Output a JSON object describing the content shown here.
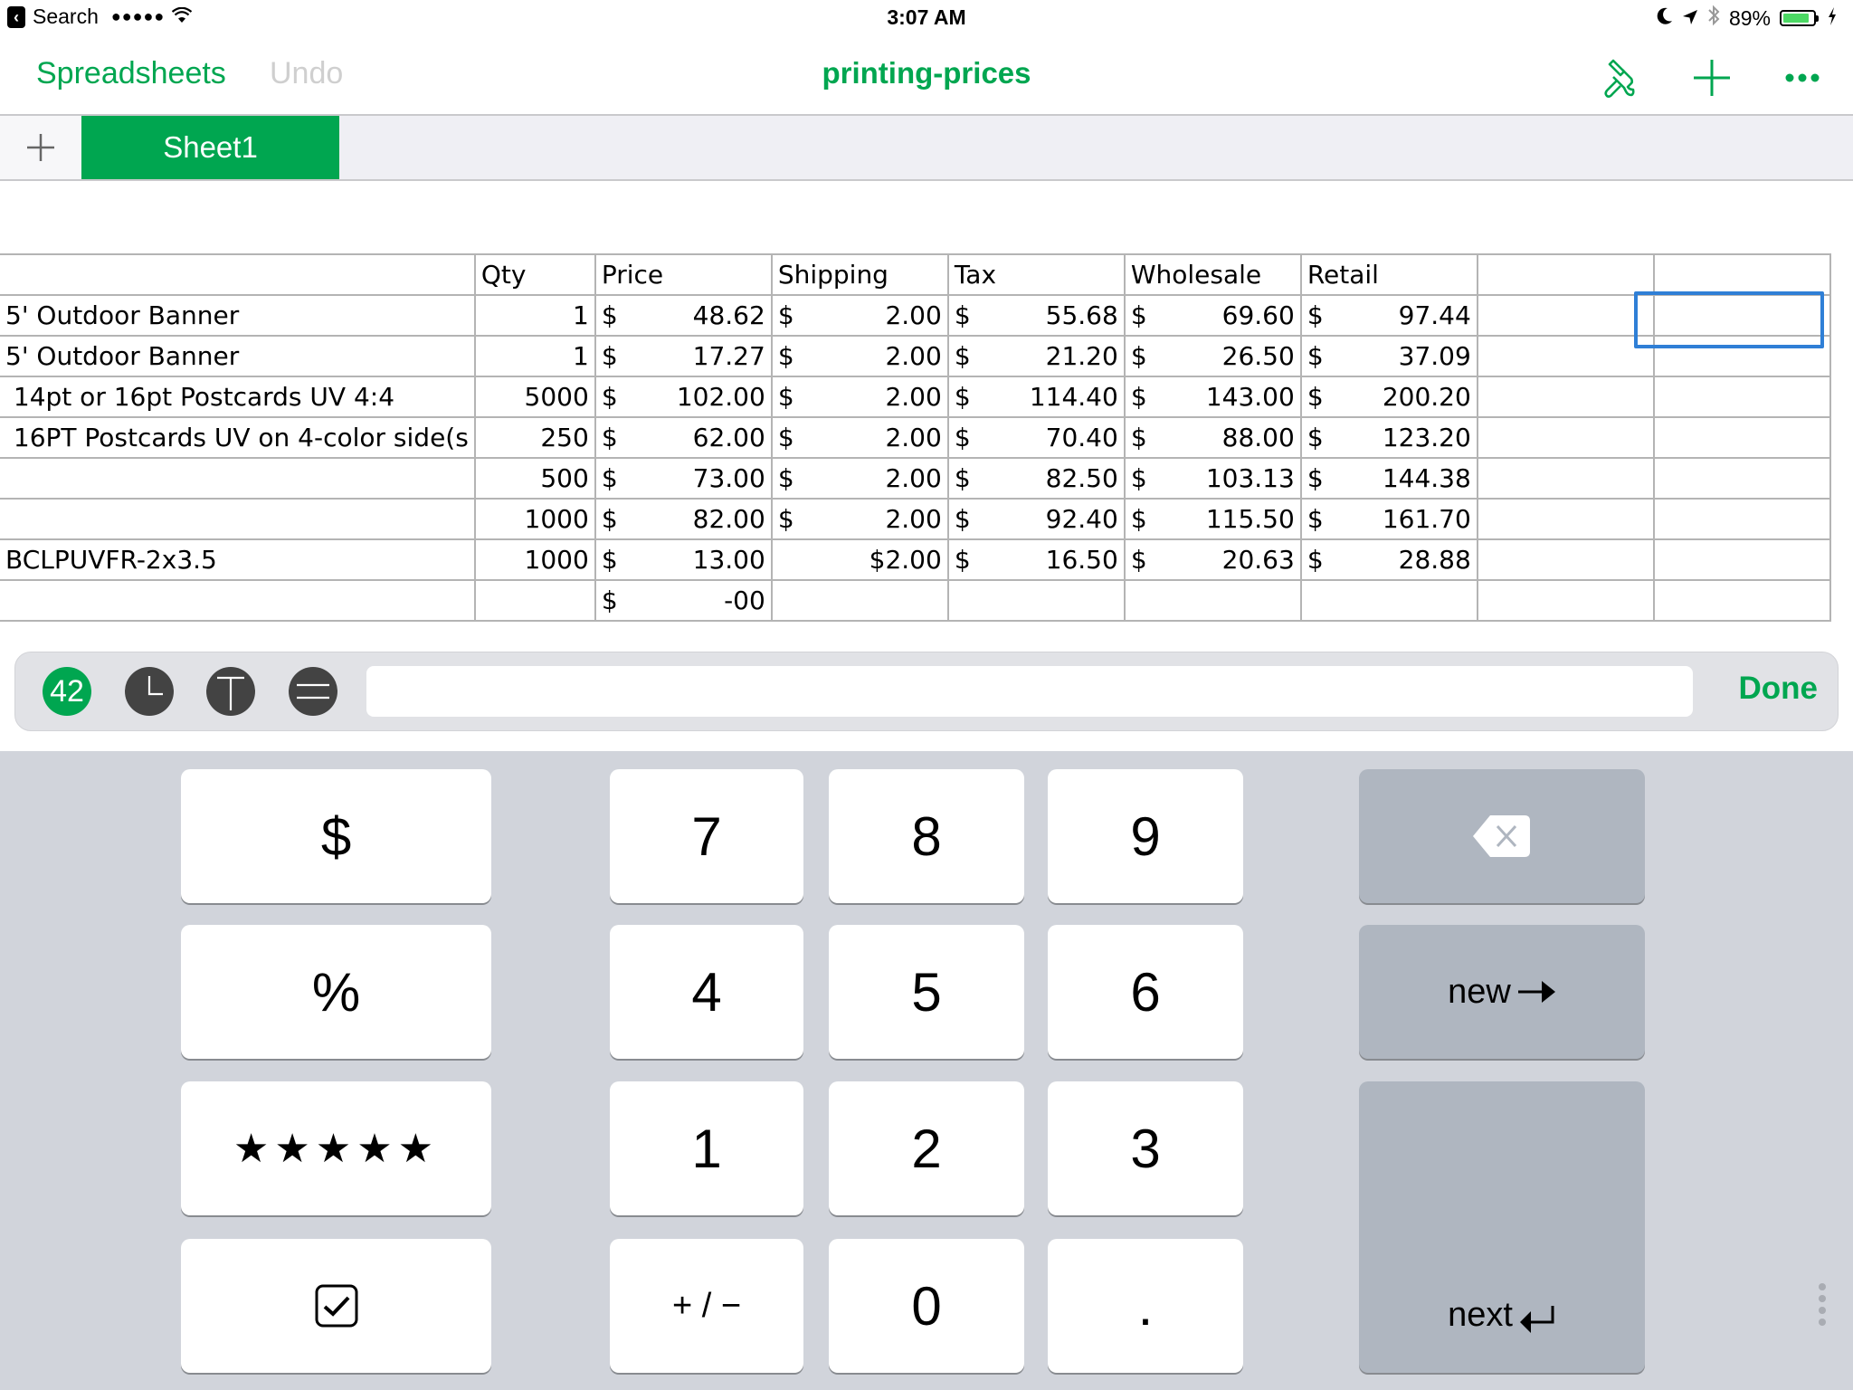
{
  "status_bar": {
    "back_label": "Search",
    "signal": "●●●●●",
    "time": "3:07 AM",
    "battery": "89%",
    "battery_level": 0.89,
    "icons": [
      "moon-icon",
      "location-arrow-icon",
      "bluetooth-icon",
      "battery-icon",
      "charging-bolt-icon"
    ]
  },
  "navbar": {
    "back_button": "Spreadsheets",
    "undo_button": "Undo",
    "title": "printing-prices",
    "icons": [
      "paintbrush-icon",
      "plus-icon",
      "more-icon"
    ]
  },
  "colors": {
    "accent": "#00a650",
    "selection": "#2f7fd6",
    "keyboard_bg": "#d1d4db",
    "key_dark": "#afb6c0"
  },
  "tabs": {
    "add_label": "+",
    "sheets": [
      {
        "label": "Sheet1",
        "active": true
      }
    ]
  },
  "table": {
    "headers": [
      "",
      "Qty",
      "Price",
      "Shipping",
      "Tax",
      "Wholesale",
      "Retail",
      "",
      ""
    ],
    "rows": [
      {
        "item": "5' Outdoor Banner",
        "qty": "1",
        "price": "48.62",
        "shipping": "2.00",
        "tax": "55.68",
        "wholesale": "69.60",
        "retail": "97.44"
      },
      {
        "item": "5' Outdoor Banner",
        "qty": "1",
        "price": "17.27",
        "shipping": "2.00",
        "tax": "21.20",
        "wholesale": "26.50",
        "retail": "37.09"
      },
      {
        "item": " 14pt or 16pt Postcards UV 4:4",
        "qty": "5000",
        "price": "102.00",
        "shipping": "2.00",
        "tax": "114.40",
        "wholesale": "143.00",
        "retail": "200.20"
      },
      {
        "item": " 16PT Postcards UV on 4-color side(s",
        "qty": "250",
        "price": "62.00",
        "shipping": "2.00",
        "tax": "70.40",
        "wholesale": "88.00",
        "retail": "123.20"
      },
      {
        "item": "",
        "qty": "500",
        "price": "73.00",
        "shipping": "2.00",
        "tax": "82.50",
        "wholesale": "103.13",
        "retail": "144.38"
      },
      {
        "item": "",
        "qty": "1000",
        "price": "82.00",
        "shipping": "2.00",
        "tax": "92.40",
        "wholesale": "115.50",
        "retail": "161.70"
      },
      {
        "item": "BCLPUVFR-2x3.5",
        "qty": "1000",
        "price": "13.00",
        "shipping_plain": "$2.00",
        "tax": "16.50",
        "wholesale": "20.63",
        "retail": "28.88"
      },
      {
        "item": "",
        "qty": "",
        "price": "-00"
      }
    ],
    "currency_symbol": "$"
  },
  "input_bar": {
    "format_buttons": [
      {
        "name": "number-format",
        "label": "42",
        "active": true
      },
      {
        "name": "date-time-format",
        "label": "",
        "active": false
      },
      {
        "name": "text-format",
        "label": "",
        "active": false
      },
      {
        "name": "formula-format",
        "label": "",
        "active": false
      }
    ],
    "cell_value": "",
    "done_label": "Done"
  },
  "keyboard": {
    "left_keys": [
      "$",
      "%",
      "★★★★★",
      "☑"
    ],
    "numpad": [
      [
        "7",
        "8",
        "9"
      ],
      [
        "4",
        "5",
        "6"
      ],
      [
        "1",
        "2",
        "3"
      ],
      [
        "+ / −",
        "0",
        "."
      ]
    ],
    "new_label": "new",
    "next_label": "next"
  }
}
